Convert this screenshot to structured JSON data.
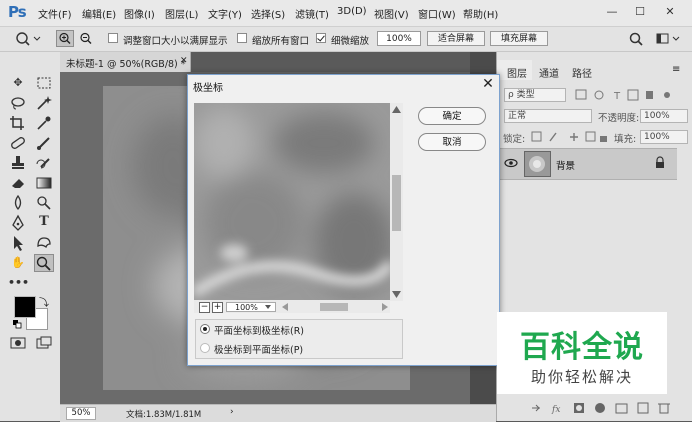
{
  "app": {
    "logo": "Ps"
  },
  "menu": [
    "文件(F)",
    "编辑(E)",
    "图像(I)",
    "图层(L)",
    "文字(Y)",
    "选择(S)",
    "滤镜(T)",
    "3D(D)",
    "视图(V)",
    "窗口(W)",
    "帮助(H)"
  ],
  "window_controls": {
    "minimize": "—",
    "maximize": "☐",
    "close": "✕"
  },
  "options_bar": {
    "resize_windows_label": "调整窗口大小以满屏显示",
    "resize_windows_checked": false,
    "zoom_all_label": "缩放所有窗口",
    "zoom_all_checked": false,
    "scrubby_zoom_label": "细微缩放",
    "scrubby_zoom_checked": true,
    "zoom_value": "100%",
    "fit_screen": "适合屏幕",
    "fill_screen": "填充屏幕"
  },
  "document": {
    "tab_title": "未标题-1 @ 50%(RGB/8) *",
    "tab_close": "✕",
    "status_zoom": "50%",
    "status_doc": "文档:1.83M/1.81M",
    "status_arrow": "›"
  },
  "layers_panel": {
    "tabs": [
      "图层",
      "通道",
      "路径"
    ],
    "kind_label": "ρ 类型",
    "blend_mode": "正常",
    "opacity_label": "不透明度:",
    "opacity_value": "100%",
    "lock_label": "锁定:",
    "fill_label": "填充:",
    "fill_value": "100%",
    "layer_name": "背景"
  },
  "dialog": {
    "title": "极坐标",
    "close": "✕",
    "ok": "确定",
    "cancel": "取消",
    "zoom_out": "−",
    "zoom_in": "+",
    "zoom_value": "100%",
    "option_rect_to_polar": "平面坐标到极坐标(R)",
    "option_polar_to_rect": "极坐标到平面坐标(P)",
    "selected_option": "rect_to_polar"
  },
  "watermark": {
    "title": "百科全说",
    "subtitle": "助你轻松解决"
  },
  "colors": {
    "accent": "#2f6fb7",
    "watermark_green": "#1fa84f",
    "dialog_border": "#7da2ce"
  }
}
